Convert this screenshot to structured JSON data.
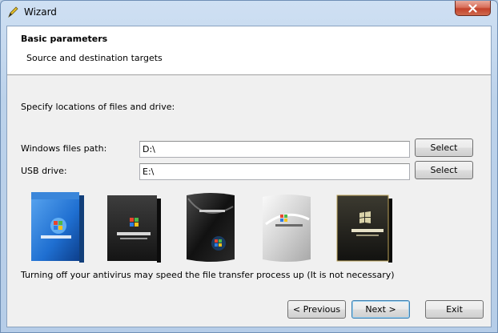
{
  "window": {
    "title": "Wizard"
  },
  "header": {
    "title": "Basic parameters",
    "subtitle": "Source and destination targets"
  },
  "body": {
    "instruction": "Specify locations of files and drive:",
    "windows_path": {
      "label": "Windows files path:",
      "value": "D:\\",
      "button": "Select"
    },
    "usb_drive": {
      "label": "USB drive:",
      "value": "E:\\",
      "button": "Select"
    },
    "note": "Turning off your antivirus may speed the file transfer process up (It is not necessary)"
  },
  "boxes": [
    {
      "icon": "windows-xp-box-icon",
      "color": "#1f6fd1"
    },
    {
      "icon": "windows-server-2003-box-icon",
      "color": "#2b2b2b"
    },
    {
      "icon": "windows-vista-box-icon",
      "color": "#1b1b1b"
    },
    {
      "icon": "windows-server-2008-box-icon",
      "color": "#d9d9d9"
    },
    {
      "icon": "windows-7-box-icon",
      "color": "#2a2a24"
    }
  ],
  "buttons": {
    "previous": "< Previous",
    "next": "Next >",
    "exit": "Exit"
  },
  "colors": {
    "accent": "#3c7fb1",
    "close": "#c3422a"
  }
}
